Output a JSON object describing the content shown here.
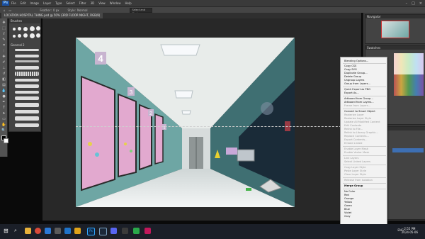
{
  "menubar": {
    "items": [
      "File",
      "Edit",
      "Image",
      "Layer",
      "Type",
      "Select",
      "Filter",
      "3D",
      "View",
      "Window",
      "Help"
    ],
    "search_placeholder": "Select and Mask..."
  },
  "options": {
    "feather_label": "Feather:",
    "feather_value": "0 px",
    "style_label": "Style:",
    "style_value": "Normal"
  },
  "document": {
    "tab_title": "LOCATION HOSPITAL THING.psd @ 50% (3RD FLOOR NIGHT, RGB/8)"
  },
  "brush_panel": {
    "title": "Brushes",
    "group_label": "General 2"
  },
  "right_panels": {
    "navigator_title": "Navigator",
    "swatches_title": "Swatches",
    "layers_title": "Layers"
  },
  "canvas": {
    "door_numbers": [
      "4",
      "3",
      "2",
      "1"
    ]
  },
  "context_menu": {
    "items": [
      {
        "label": "Blending Options...",
        "state": "enabled"
      },
      {
        "label": "Copy CSS",
        "state": "enabled"
      },
      {
        "label": "Copy SVG",
        "state": "enabled"
      },
      {
        "label": "Duplicate Group...",
        "state": "enabled"
      },
      {
        "label": "Delete Group",
        "state": "enabled"
      },
      {
        "label": "Ungroup Layers",
        "state": "enabled"
      },
      {
        "label": "Group from Layers...",
        "state": "enabled"
      },
      {
        "label": "Quick Export as PNG",
        "state": "enabled"
      },
      {
        "label": "Export As...",
        "state": "enabled"
      },
      {
        "label": "Artboard from Group...",
        "state": "enabled"
      },
      {
        "label": "Artboard from Layers...",
        "state": "enabled"
      },
      {
        "label": "Frame from Layers...",
        "state": "disabled"
      },
      {
        "label": "Convert to Smart Object",
        "state": "enabled"
      },
      {
        "label": "Rasterize Layer",
        "state": "disabled"
      },
      {
        "label": "Rasterize Layer Style",
        "state": "disabled"
      },
      {
        "label": "Update All Modified Content",
        "state": "disabled"
      },
      {
        "label": "Edit Contents",
        "state": "disabled"
      },
      {
        "label": "Relink to File...",
        "state": "disabled"
      },
      {
        "label": "Relink to Library Graphic...",
        "state": "disabled"
      },
      {
        "label": "Replace Contents...",
        "state": "disabled"
      },
      {
        "label": "Export Contents...",
        "state": "disabled"
      },
      {
        "label": "Embed Linked",
        "state": "disabled"
      },
      {
        "label": "Enable Layer Mask",
        "state": "disabled"
      },
      {
        "label": "Enable Vector Mask",
        "state": "disabled"
      },
      {
        "label": "Link Layers",
        "state": "disabled"
      },
      {
        "label": "Select Linked Layers",
        "state": "disabled"
      },
      {
        "label": "Copy Layer Style",
        "state": "disabled"
      },
      {
        "label": "Paste Layer Style",
        "state": "disabled"
      },
      {
        "label": "Clear Layer Style",
        "state": "disabled"
      },
      {
        "label": "Release from Isolation",
        "state": "disabled"
      },
      {
        "label": "Merge Group",
        "state": "bold"
      },
      {
        "label": "No Color",
        "state": "enabled"
      },
      {
        "label": "Red",
        "state": "enabled"
      },
      {
        "label": "Orange",
        "state": "enabled"
      },
      {
        "label": "Yellow",
        "state": "enabled"
      },
      {
        "label": "Green",
        "state": "enabled"
      },
      {
        "label": "Blue",
        "state": "enabled"
      },
      {
        "label": "Violet",
        "state": "enabled"
      },
      {
        "label": "Gray",
        "state": "enabled"
      }
    ]
  },
  "taskbar": {
    "clock_time": "2:55 PM",
    "clock_date": "2024-05-06",
    "tray_lang": "ENG"
  },
  "colors": {
    "wall_teal": "#6ea6a4",
    "door_pink": "#e2a9cf",
    "ps_dark": "#282828"
  }
}
